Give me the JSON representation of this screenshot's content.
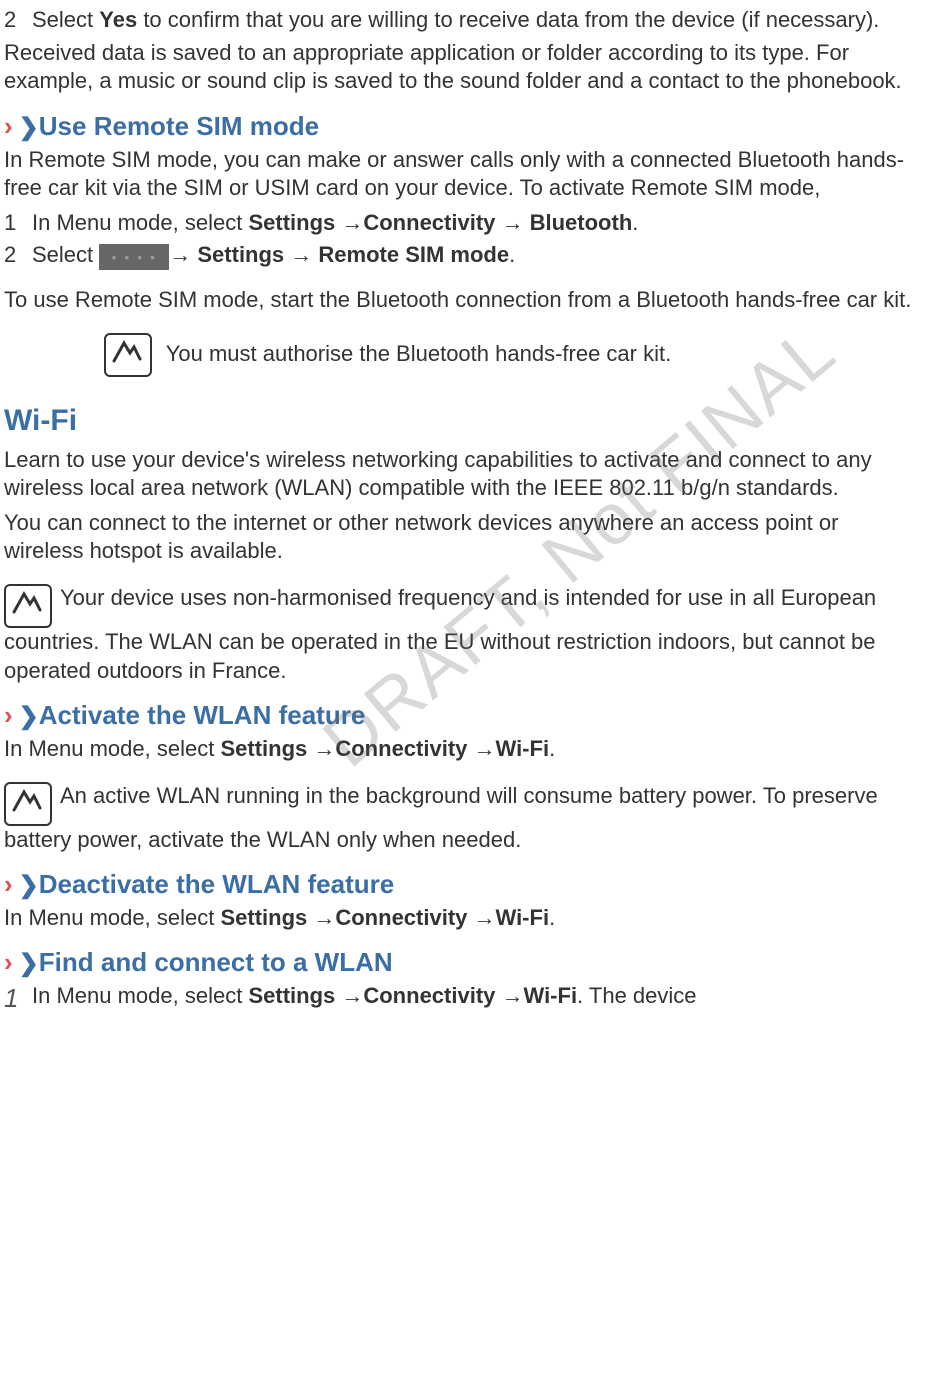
{
  "watermark": "DRAFT, Not FINAL",
  "step1": {
    "num": "2",
    "pre": "Select ",
    "bold": "Yes",
    "post": " to confirm that you are willing to receive data from the device (if necessary)."
  },
  "para_received": "Received data is saved to an appropriate application or folder according to its type. For example, a music or sound clip is saved to the sound folder and a contact to the phonebook.",
  "h_remote_sim": "Use Remote SIM mode",
  "para_remote_sim": "In Remote SIM mode, you can make or answer calls only with a connected Bluetooth hands-free car kit via the SIM or USIM card on your device. To activate Remote SIM mode,",
  "rs_step1": {
    "num": "1",
    "pre": "In Menu mode, select ",
    "b1": "Settings ",
    "arr1": "→",
    "b2": "Connectivity ",
    "arr2": "→",
    "b3": " Bluetooth",
    "dot": "."
  },
  "rs_step2": {
    "num": "2",
    "pre": "Select  ",
    "arr1": "→",
    "b1": " Settings ",
    "arr2": "→",
    "b2": " Remote SIM mode",
    "dot": "."
  },
  "para_use_remote": "To use Remote SIM mode, start the Bluetooth connection from a Bluetooth hands-free car kit.",
  "note_authorise": "You must authorise the Bluetooth hands-free car kit.",
  "h_wifi": "Wi-Fi",
  "para_wifi1": "Learn to use your device's wireless networking capabilities to activate and connect to any wireless local area network (WLAN) compatible with the IEEE 802.11 b/g/n standards.",
  "para_wifi2": "You can connect to the internet or other network devices anywhere an access point or wireless hotspot is available.",
  "note_freq": "Your device uses non-harmonised frequency and is intended for use in all European countries. The WLAN can be operated in the EU without restriction indoors, but cannot be operated outdoors in France.",
  "h_activate": "Activate the WLAN feature",
  "para_activate_pre": "In Menu mode, select ",
  "nav": {
    "b1": "Settings ",
    "arr": "→",
    "b2": "Connectivity ",
    "b3": "Wi-Fi",
    "dot": "."
  },
  "note_battery": "An active WLAN running in the background will consume battery power. To preserve battery power, activate the WLAN only when needed.",
  "h_deactivate": "Deactivate the WLAN feature",
  "para_deactivate_pre": "In Menu mode, select ",
  "h_find": "Find and connect to a WLAN",
  "find_step1": {
    "num": "1",
    "pre": " In Menu mode, select ",
    "post": ". The device"
  }
}
